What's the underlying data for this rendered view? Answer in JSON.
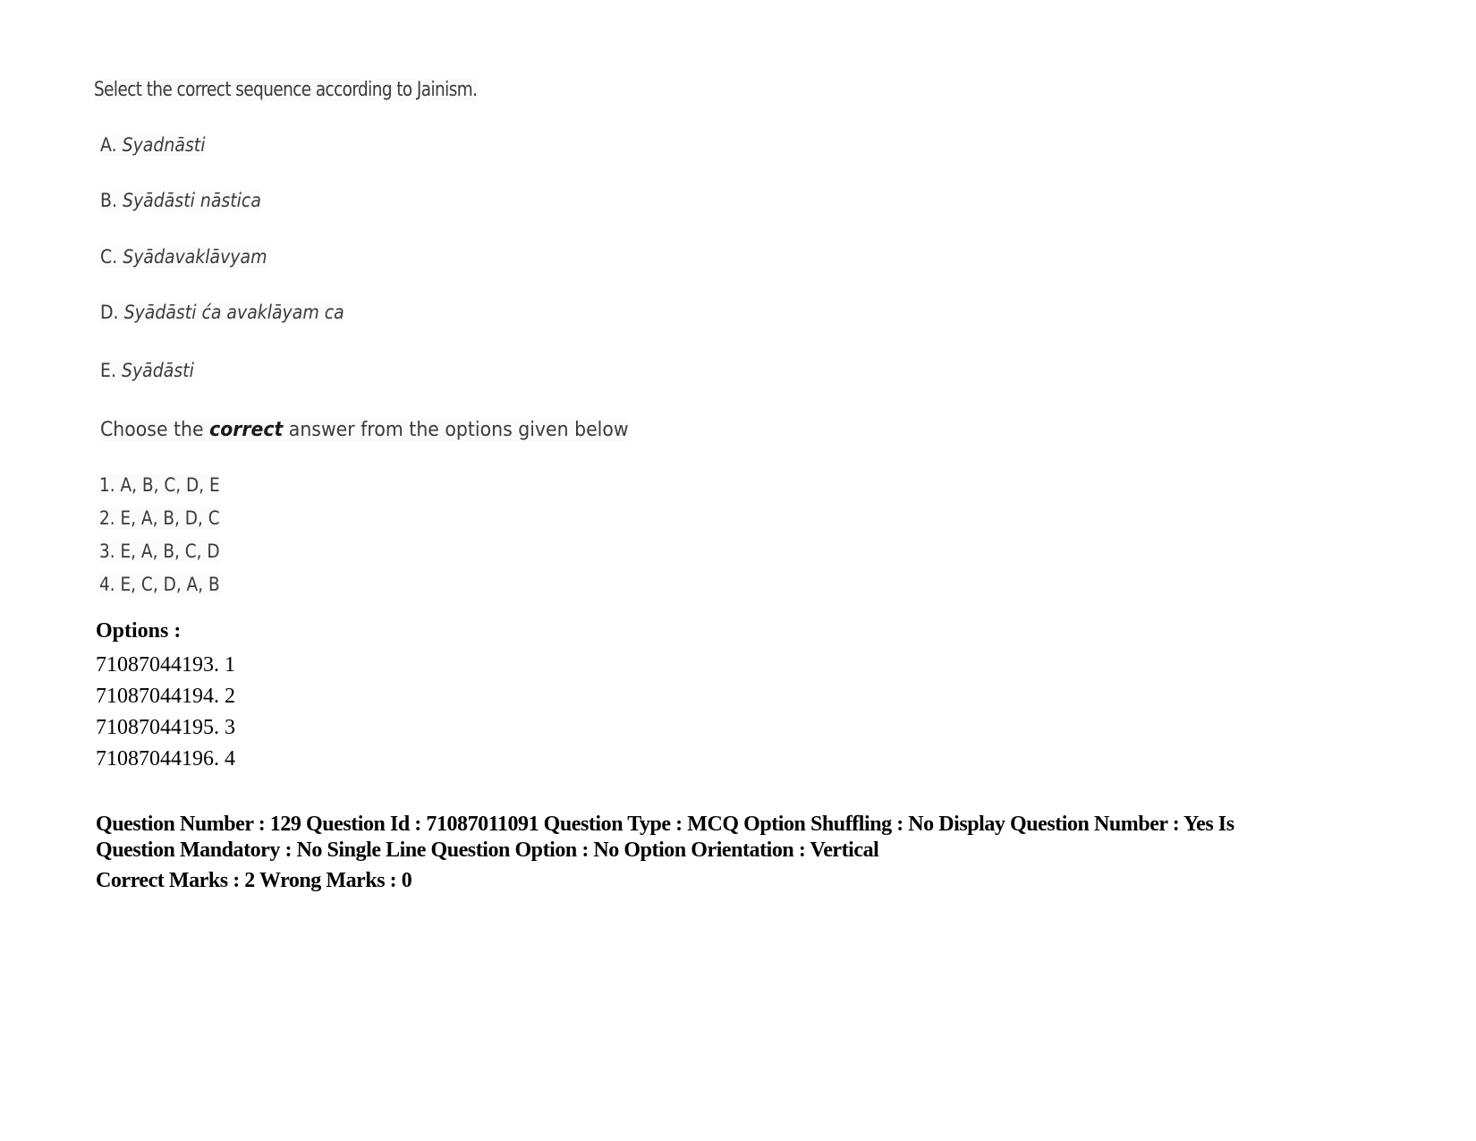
{
  "question": {
    "stem": "Select the correct sequence according to Jainism.",
    "statements": [
      {
        "label": "A.",
        "term": "Syadnāsti"
      },
      {
        "label": "B.",
        "term": "Syādāsti nāstica"
      },
      {
        "label": "C.",
        "term": "Syādavaklāvyam"
      },
      {
        "label": "D.",
        "term": "Syādāsti ća avaklāyam ca"
      },
      {
        "label": "E.",
        "term": "Syādāsti"
      }
    ],
    "instruction": {
      "before": "Choose the ",
      "emphasis": "correct",
      "after": " answer from the options given below"
    },
    "sequences": [
      "1. A, B, C, D, E",
      "2. E, A, B, D, C",
      "3. E, A, B, C, D",
      "4. E, C, D, A, B"
    ]
  },
  "options": {
    "heading": "Options :",
    "items": [
      "71087044193. 1",
      "71087044194. 2",
      "71087044195. 3",
      "71087044196. 4"
    ]
  },
  "metadata": {
    "line1": "Question Number : 129 Question Id : 71087011091 Question Type : MCQ Option Shuffling : No Display Question Number : Yes Is",
    "line2": "Question Mandatory : No Single Line Question Option : No Option Orientation : Vertical",
    "line3": "Correct Marks : 2 Wrong Marks : 0"
  }
}
